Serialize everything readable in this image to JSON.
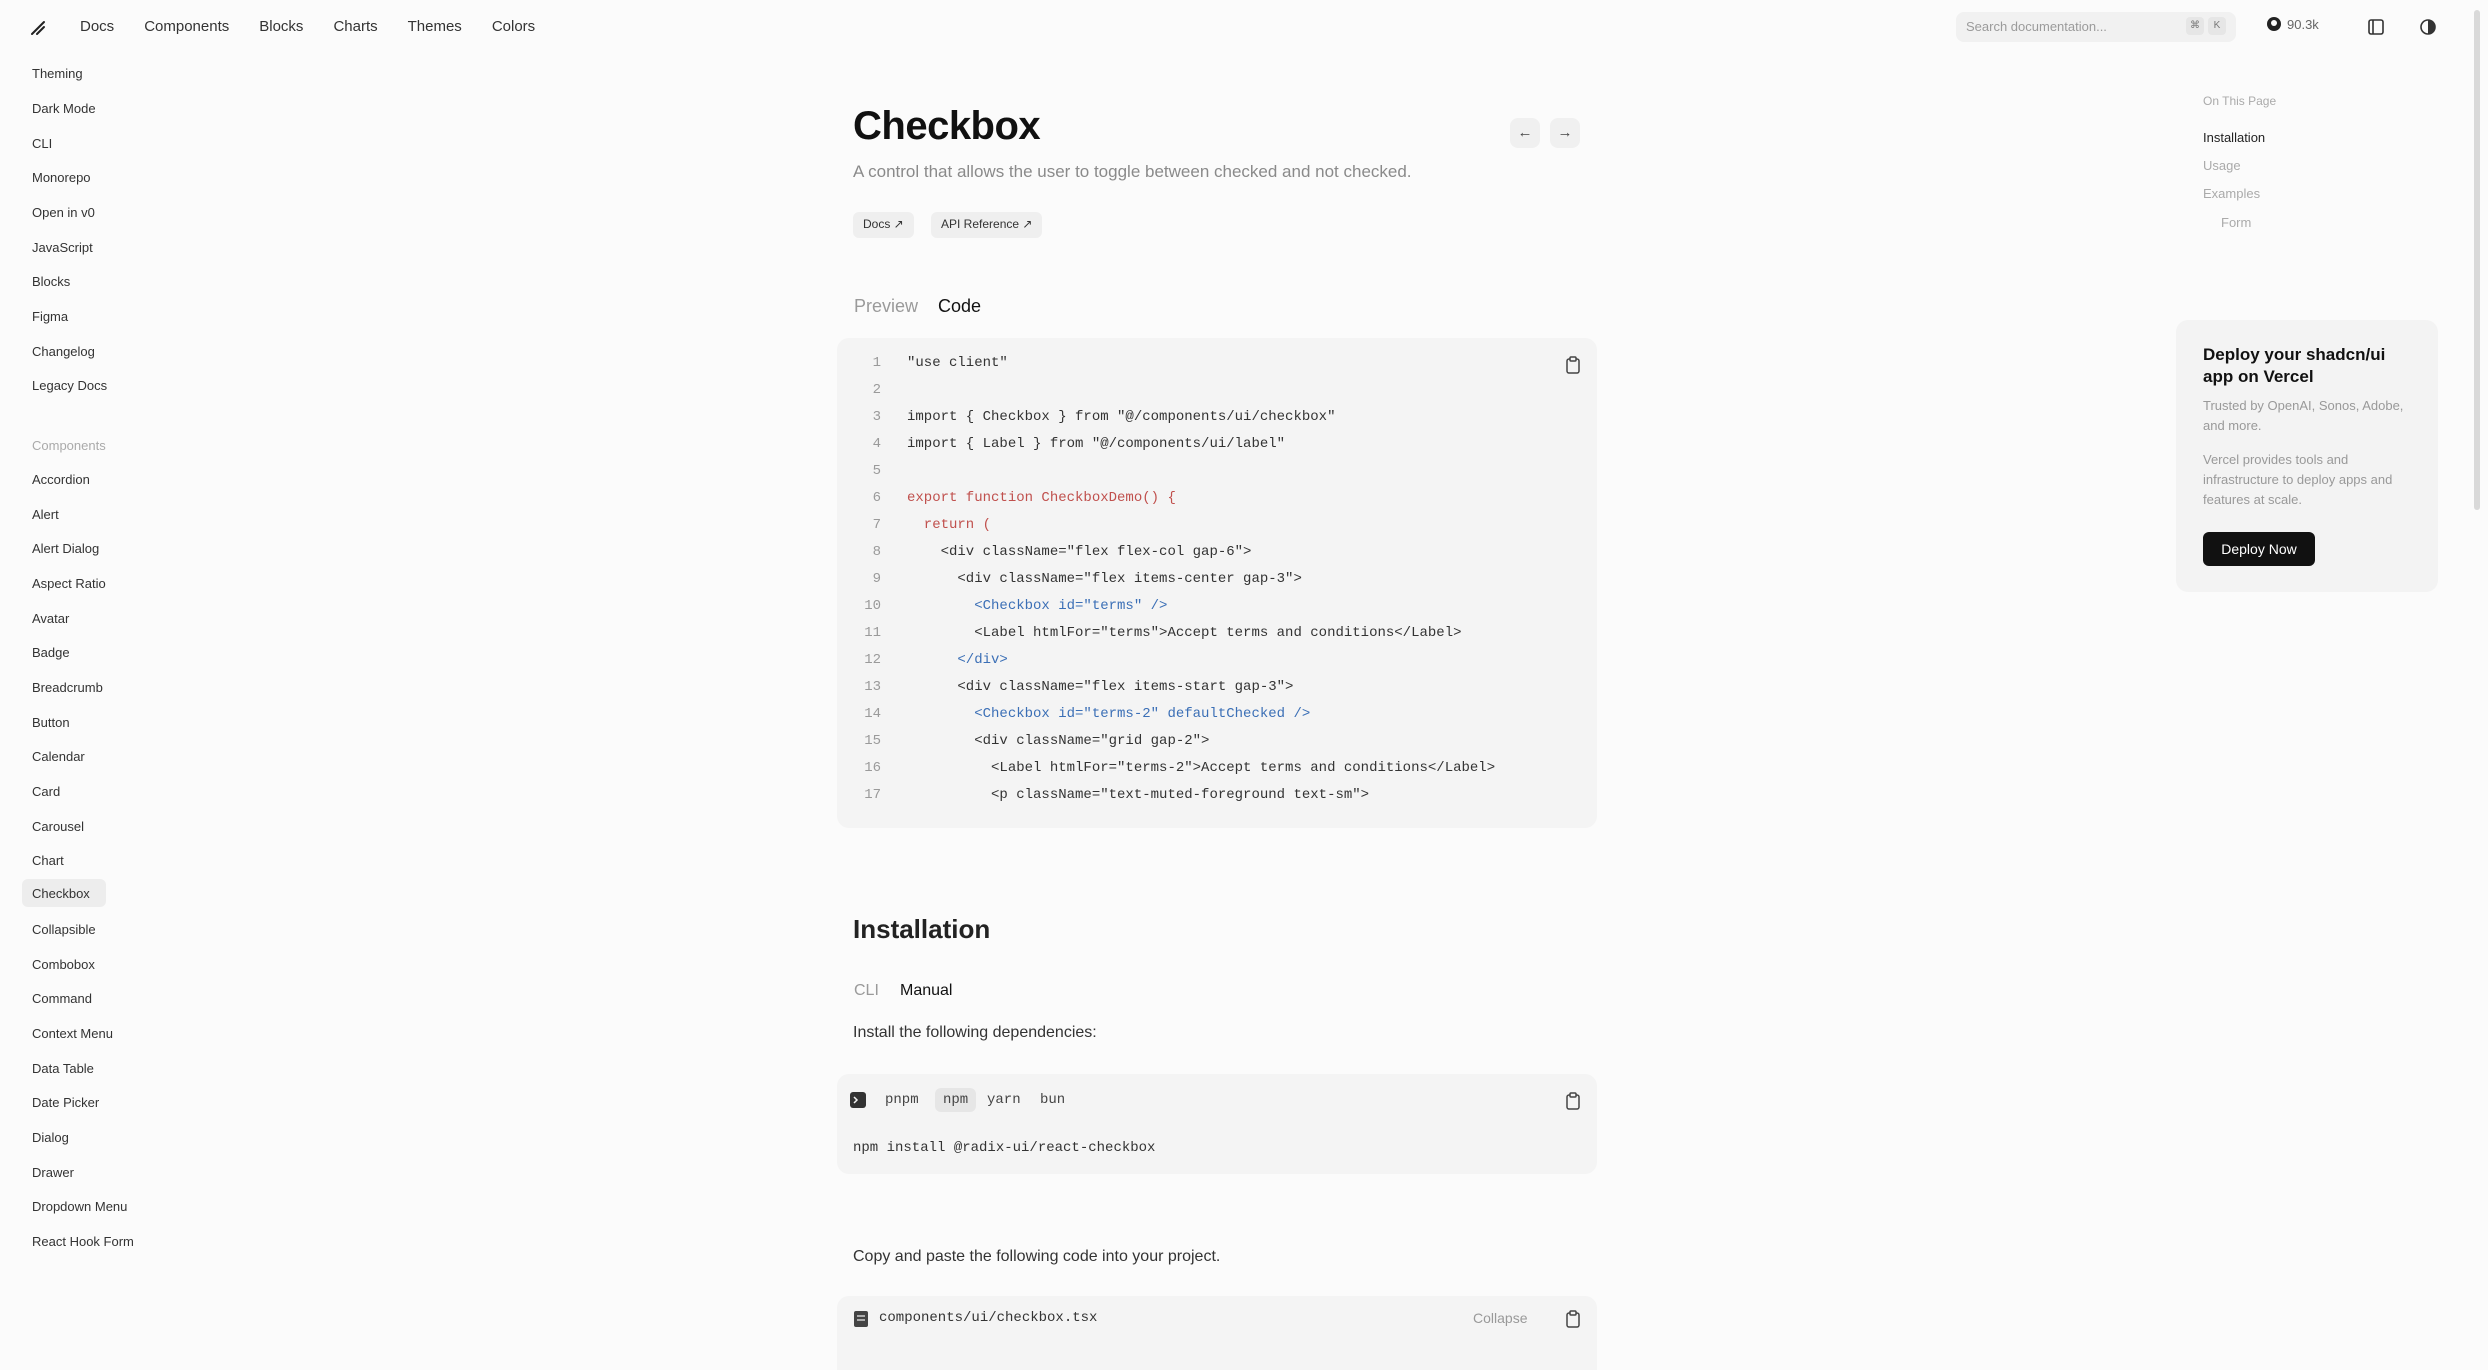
{
  "topnav": {
    "items": [
      "Docs",
      "Components",
      "Blocks",
      "Charts",
      "Themes",
      "Colors"
    ],
    "search_placeholder": "Search documentation...",
    "search_kbd_1": "⌘",
    "search_kbd_2": "K",
    "github_stars": "90.3k"
  },
  "sidebar": {
    "top_items": [
      "Theming",
      "Dark Mode",
      "CLI",
      "Monorepo",
      "Open in v0",
      "JavaScript",
      "Blocks",
      "Figma",
      "Changelog",
      "Legacy Docs"
    ],
    "components_heading": "Components",
    "component_items": [
      "Accordion",
      "Alert",
      "Alert Dialog",
      "Aspect Ratio",
      "Avatar",
      "Badge",
      "Breadcrumb",
      "Button",
      "Calendar",
      "Card",
      "Carousel",
      "Chart",
      "Checkbox",
      "Collapsible",
      "Combobox",
      "Command",
      "Context Menu",
      "Data Table",
      "Date Picker",
      "Dialog",
      "Drawer",
      "Dropdown Menu",
      "React Hook Form"
    ],
    "active_item": "Checkbox"
  },
  "page": {
    "title": "Checkbox",
    "description": "A control that allows the user to toggle between checked and not checked.",
    "prev_arrow": "←",
    "next_arrow": "→",
    "pills": [
      "Docs ↗",
      "API Reference ↗"
    ],
    "tabs": [
      "Preview",
      "Code"
    ],
    "active_tab": "Code"
  },
  "code": {
    "line_numbers": [
      "1",
      "2",
      "3",
      "4",
      "5",
      "6",
      "7",
      "8",
      "9",
      "10",
      "11",
      "12",
      "13",
      "14",
      "15",
      "16",
      "17"
    ],
    "lines": [
      "\"use client\"",
      "",
      "import { Checkbox } from \"@/components/ui/checkbox\"",
      "import { Label } from \"@/components/ui/label\"",
      "",
      "export function CheckboxDemo() {",
      "  return (",
      "    <div className=\"flex flex-col gap-6\">",
      "      <div className=\"flex items-center gap-3\">",
      "        <Checkbox id=\"terms\" />",
      "        <Label htmlFor=\"terms\">Accept terms and conditions</Label>",
      "      </div>",
      "      <div className=\"flex items-start gap-3\">",
      "        <Checkbox id=\"terms-2\" defaultChecked />",
      "        <div className=\"grid gap-2\">",
      "          <Label htmlFor=\"terms-2\">Accept terms and conditions</Label>",
      "          <p className=\"text-muted-foreground text-sm\">"
    ]
  },
  "installation": {
    "heading": "Installation",
    "tabs": [
      "CLI",
      "Manual"
    ],
    "active_tab": "Manual",
    "deps_text": "Install the following dependencies:",
    "pm_tabs": [
      "pnpm",
      "npm",
      "yarn",
      "bun"
    ],
    "active_pm": "npm",
    "command": "npm install @radix-ui/react-checkbox",
    "copy_text": "Copy and paste the following code into your project.",
    "file_name": "components/ui/checkbox.tsx",
    "collapse_label": "Collapse"
  },
  "toc": {
    "heading": "On This Page",
    "items": [
      "Installation",
      "Usage",
      "Examples",
      "Form"
    ],
    "active": "Installation"
  },
  "promo": {
    "title": "Deploy your shadcn/ui app on Vercel",
    "line1": "Trusted by OpenAI, Sonos, Adobe, and more.",
    "line2": "Vercel provides tools and infrastructure to deploy apps and features at scale.",
    "button": "Deploy Now"
  },
  "colors": {
    "accent": "#111111",
    "keyword": "#c0504d",
    "tag": "#3b6fb6"
  }
}
